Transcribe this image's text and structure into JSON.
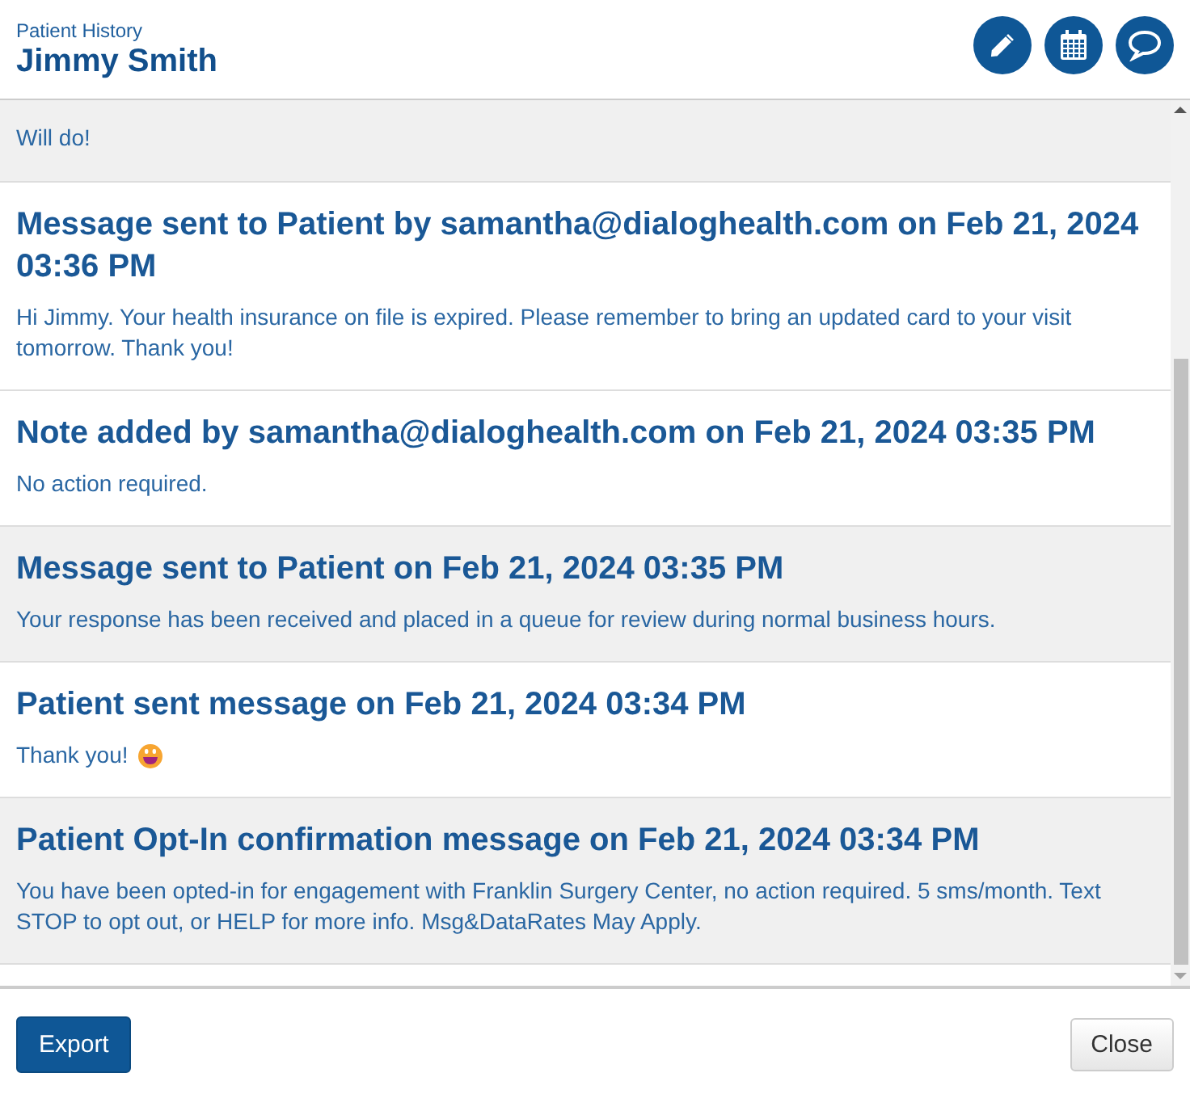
{
  "header": {
    "subtitle": "Patient History",
    "title": "Jimmy Smith"
  },
  "entries": [
    {
      "body": "Will do!",
      "shaded": true,
      "emoji": false
    },
    {
      "heading": "Message sent to Patient by samantha@dialoghealth.com on Feb 21, 2024 03:36 PM",
      "body": "Hi Jimmy. Your health insurance on file is expired. Please remember to bring an updated card to your visit tomorrow. Thank you!",
      "shaded": false,
      "emoji": false
    },
    {
      "heading": "Note added by samantha@dialoghealth.com on Feb 21, 2024 03:35 PM",
      "body": "No action required.",
      "shaded": false,
      "emoji": false
    },
    {
      "heading": "Message sent to Patient on Feb 21, 2024 03:35 PM",
      "body": "Your response has been received and placed in a queue for review during normal business hours.",
      "shaded": true,
      "emoji": false
    },
    {
      "heading": "Patient sent message on Feb 21, 2024 03:34 PM",
      "body": "Thank you!",
      "shaded": false,
      "emoji": true
    },
    {
      "heading": "Patient Opt-In confirmation message on Feb 21, 2024 03:34 PM",
      "body": "You have been opted-in for engagement with Franklin Surgery Center, no action required. 5 sms/month. Text STOP to opt out, or HELP for more info. Msg&DataRates May Apply.",
      "shaded": true,
      "emoji": false
    }
  ],
  "footer": {
    "export": "Export",
    "close": "Close"
  }
}
